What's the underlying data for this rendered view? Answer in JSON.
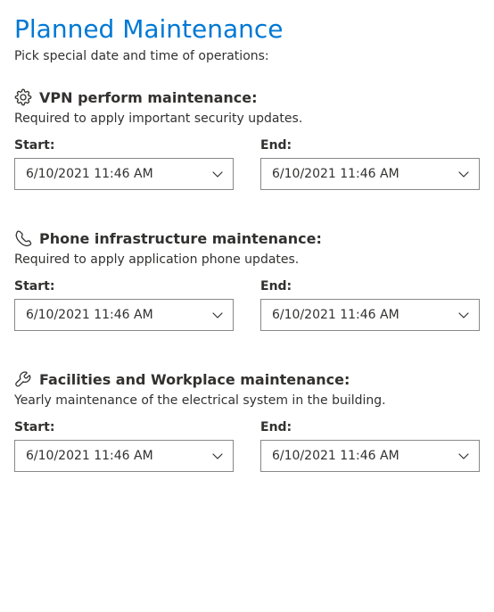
{
  "page": {
    "title": "Planned Maintenance",
    "subtitle": "Pick special date and time of operations:"
  },
  "labels": {
    "start": "Start:",
    "end": "End:"
  },
  "sections": {
    "vpn": {
      "title": "VPN perform maintenance:",
      "desc": "Required to apply important security updates.",
      "start": "6/10/2021 11:46 AM",
      "end": "6/10/2021 11:46 AM"
    },
    "phone": {
      "title": "Phone infrastructure maintenance:",
      "desc": "Required to apply application phone updates.",
      "start": "6/10/2021 11:46 AM",
      "end": "6/10/2021 11:46 AM"
    },
    "facilities": {
      "title": "Facilities and Workplace maintenance:",
      "desc": "Yearly maintenance of the electrical system in the building.",
      "start": "6/10/2021 11:46 AM",
      "end": "6/10/2021 11:46 AM"
    }
  }
}
